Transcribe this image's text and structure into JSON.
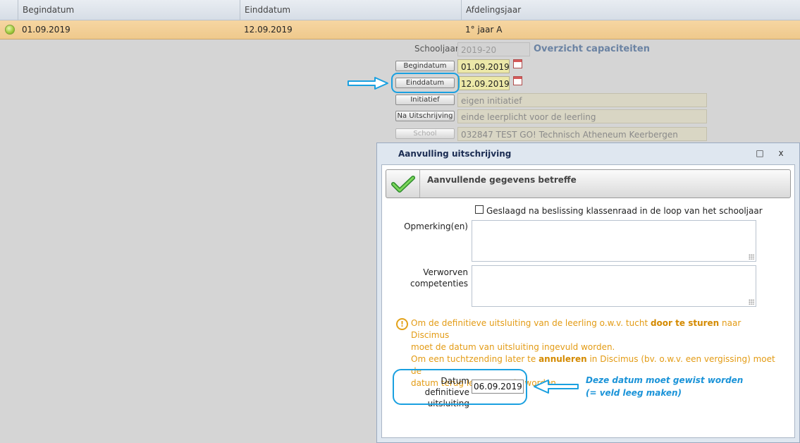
{
  "grid": {
    "columns": [
      "Begindatum",
      "Einddatum",
      "Afdelingsjaar"
    ],
    "rows": [
      {
        "begindatum": "01.09.2019",
        "einddatum": "12.09.2019",
        "afdelingsjaar": "1° jaar A"
      }
    ]
  },
  "form": {
    "schooljaar_label": "Schooljaar",
    "schooljaar_value": "2019-20",
    "overview_link": "Overzicht capaciteiten",
    "begindatum_button": "Begindatum",
    "begindatum_value": "01.09.2019",
    "einddatum_button": "Einddatum",
    "einddatum_value": "12.09.2019",
    "initiatief_button": "Initiatief",
    "initiatief_value": "eigen initiatief",
    "na_uitschrijving_button": "Na Uitschrijving",
    "na_uitschrijving_value": "einde leerplicht voor de leerling",
    "school_button": "School",
    "school_value": "032847 TEST GO! Technisch Atheneum Keerbergen"
  },
  "dialog": {
    "title": "Aanvulling uitschrijving",
    "maximize_icon": "□",
    "close_icon": "x",
    "header_title": "Aanvullende gegevens betreffе",
    "checkbox_label": "Geslaagd na beslissing klassenraad in de loop van het schooljaar",
    "opmerking_label": "Opmerking(en)",
    "verworven_label_1": "Verworven",
    "verworven_label_2": "competenties",
    "warning": {
      "line1_pre": "Om de definitieve uitsluiting van de leerling o.w.v. tucht ",
      "line1_bold": "door te sturen",
      "line1_post": " naar Discimus",
      "line2": "moet de datum van uitsluiting ingevuld worden.",
      "line3_pre": "Om een tuchtzending later te ",
      "line3_bold": "annuleren",
      "line3_post": " in Discimus (bv. o.w.v. een vergissing) moet de",
      "line4": "datum terug leeggemaakt worden."
    },
    "datum_label_1": "Datum definitieve",
    "datum_label_2": "uitsluiting",
    "datum_value": "06.09.2019"
  },
  "annotation": {
    "line1": "Deze datum moet gewist worden",
    "line2": "(= veld leeg maken)",
    "color": "#1aa0e0"
  },
  "colors": {
    "selected_row": "#f2cd92",
    "field_active": "#ece8a8",
    "warning": "#e39b14"
  }
}
